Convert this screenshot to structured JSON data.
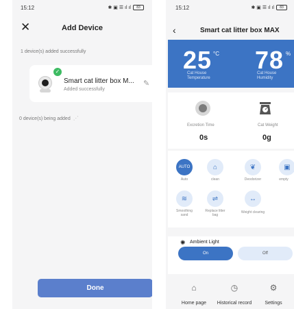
{
  "left": {
    "status": {
      "time": "15:12",
      "icons": "✱ ▣ ☰ ıl ıl",
      "battery": "83"
    },
    "header": {
      "close": "✕",
      "title": "Add Device"
    },
    "added_note": "1 device(s) added successfully",
    "device": {
      "name": "Smart cat litter box M...",
      "status": "Added successfully",
      "check": "✓",
      "edit": "✎"
    },
    "adding_note": "0 device(s) being added",
    "spinner": "⋰",
    "done_label": "Done"
  },
  "right": {
    "status": {
      "time": "15:12",
      "icons": "✱ ▣ ☰ ıl ıl",
      "battery": "83"
    },
    "header": {
      "back": "‹",
      "title": "Smart cat litter box MAX",
      "more": "⋮"
    },
    "temperature": {
      "value": "25",
      "unit": "°C",
      "label_line1": "Cat House",
      "label_line2": "Temperature"
    },
    "humidity": {
      "value": "78",
      "unit": "%",
      "label_line1": "Cat House",
      "label_line2": "Humidity"
    },
    "excretion": {
      "label": "Excretion Time",
      "value": "0s"
    },
    "weight": {
      "label": "Cat Weight",
      "value": "0g"
    },
    "modes": [
      {
        "label": "Auto",
        "glyph": "AUTO"
      },
      {
        "label": "clean",
        "glyph": "⌂"
      },
      {
        "label": "Deodorizer",
        "glyph": "❦"
      },
      {
        "label": "empty",
        "glyph": "▣"
      },
      {
        "label_line1": "Smoothing",
        "label_line2": "sand",
        "glyph": "≋"
      },
      {
        "label_line1": "Replace litter",
        "label_line2": "bag",
        "glyph": "⇌"
      },
      {
        "label": "Weight clearing",
        "glyph": "↔"
      }
    ],
    "ambient": {
      "icon": "✺",
      "title": "Ambient Light",
      "on_label": "On",
      "off_label": "Off"
    },
    "nav": [
      {
        "label": "Home page",
        "glyph": "⌂"
      },
      {
        "label": "Historical record",
        "glyph": "◷"
      },
      {
        "label": "Settings",
        "glyph": "⚙"
      }
    ],
    "colors": {
      "accent": "#3c74c4",
      "accent_light": "#e1ebf9"
    }
  }
}
